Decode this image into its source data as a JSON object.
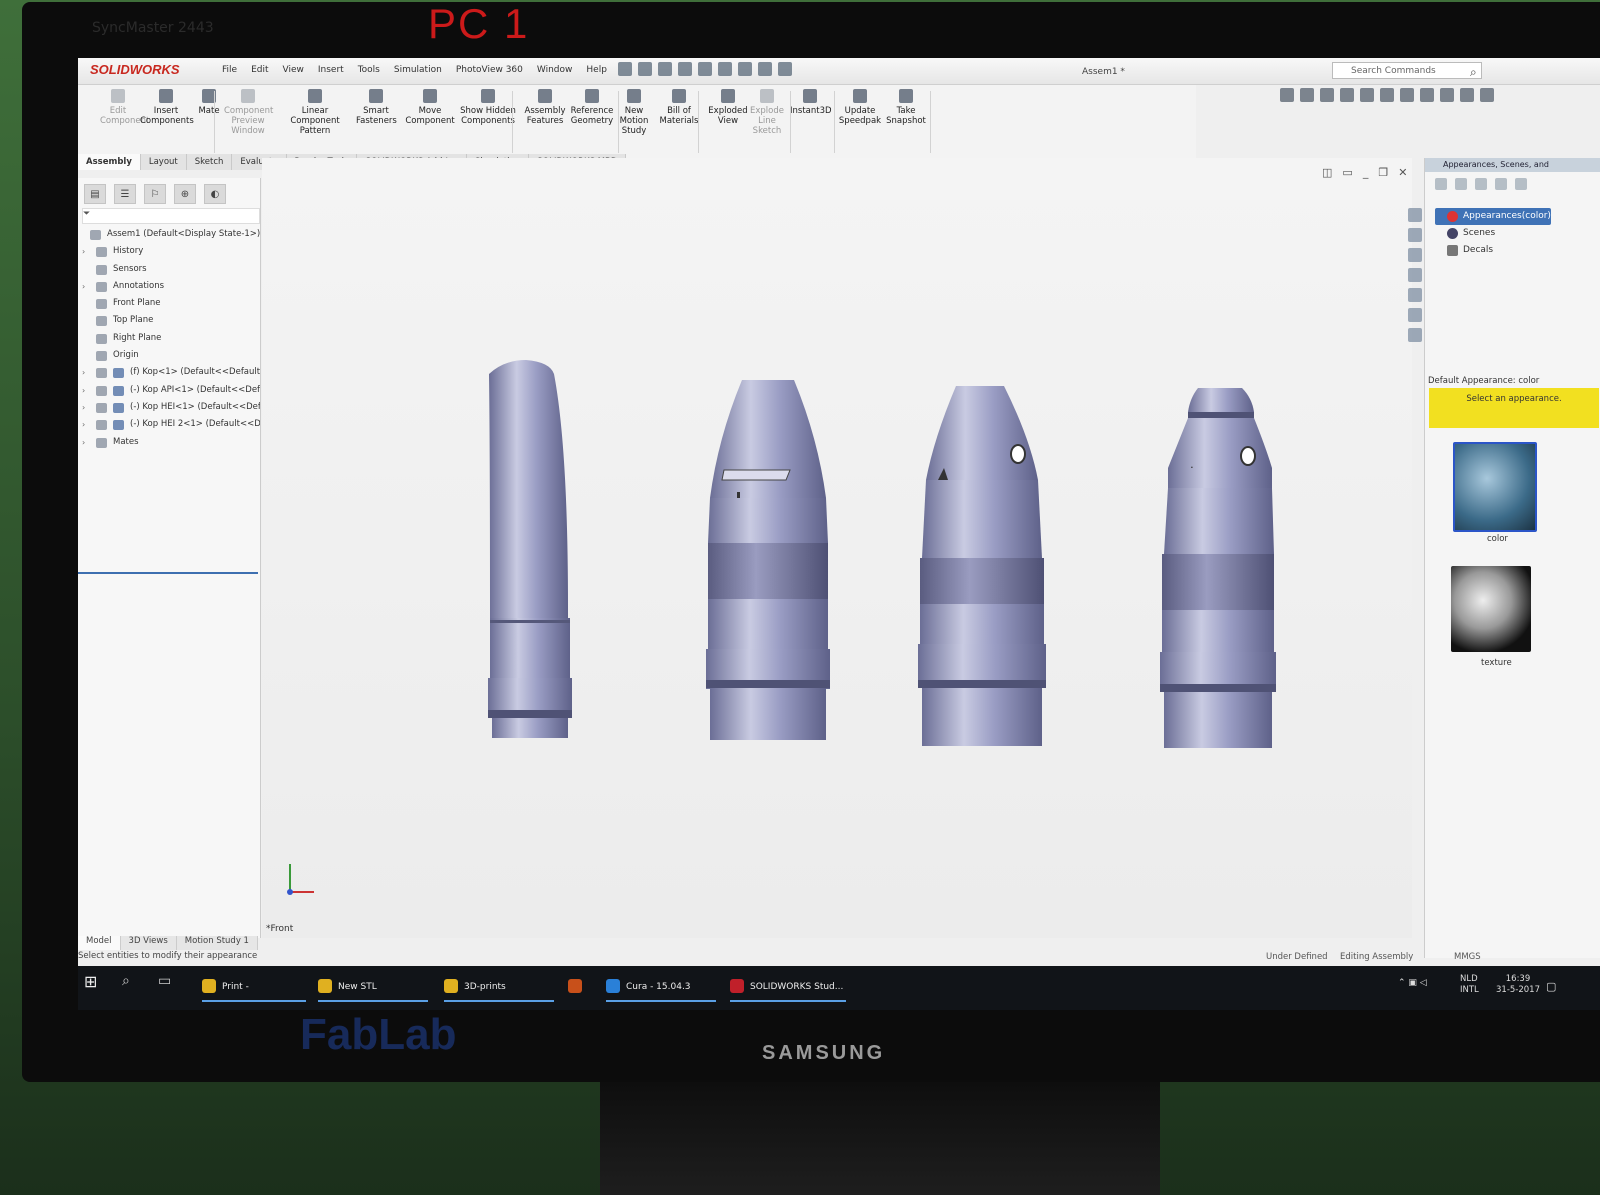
{
  "photo": {
    "pc_label": "PC 1",
    "monitor_brand_top": "SyncMaster 2443",
    "monitor_brand": "SAMSUNG",
    "wall_sign": "FabLab"
  },
  "app": {
    "logo": "SOLIDWORKS",
    "menus": [
      "File",
      "Edit",
      "View",
      "Insert",
      "Tools",
      "Simulation",
      "PhotoView 360",
      "Window",
      "Help"
    ],
    "doc_title": "Assem1 *",
    "search_placeholder": "Search Commands"
  },
  "commands": [
    {
      "label": "Edit Component",
      "icon": "edit-component-icon",
      "enabled": false
    },
    {
      "label": "Insert Components",
      "icon": "insert-components-icon",
      "enabled": true
    },
    {
      "label": "Mate",
      "icon": "mate-icon",
      "enabled": true
    },
    {
      "label": "Component Preview Window",
      "icon": "preview-window-icon",
      "enabled": false
    },
    {
      "label": "Linear Component Pattern",
      "icon": "linear-pattern-icon",
      "enabled": true
    },
    {
      "label": "Smart Fasteners",
      "icon": "smart-fasteners-icon",
      "enabled": true
    },
    {
      "label": "Move Component",
      "icon": "move-component-icon",
      "enabled": true
    },
    {
      "label": "Show Hidden Components",
      "icon": "show-hidden-icon",
      "enabled": true
    },
    {
      "label": "Assembly Features",
      "icon": "assembly-features-icon",
      "enabled": true
    },
    {
      "label": "Reference Geometry",
      "icon": "reference-geometry-icon",
      "enabled": true
    },
    {
      "label": "New Motion Study",
      "icon": "motion-study-icon",
      "enabled": true
    },
    {
      "label": "Bill of Materials",
      "icon": "bom-icon",
      "enabled": true
    },
    {
      "label": "Exploded View",
      "icon": "exploded-view-icon",
      "enabled": true
    },
    {
      "label": "Explode Line Sketch",
      "icon": "explode-line-icon",
      "enabled": false
    },
    {
      "label": "Instant3D",
      "icon": "instant3d-icon",
      "enabled": true
    },
    {
      "label": "Update Speedpak",
      "icon": "speedpak-icon",
      "enabled": true
    },
    {
      "label": "Take Snapshot",
      "icon": "snapshot-icon",
      "enabled": true
    }
  ],
  "tabs": [
    "Assembly",
    "Layout",
    "Sketch",
    "Evaluate",
    "Render Tools",
    "SOLIDWORKS Add-Ins",
    "Simulation",
    "SOLIDWORKS MBD"
  ],
  "active_tab": "Assembly",
  "tree": [
    {
      "label": "Assem1  (Default<Display State-1>)",
      "expand": false,
      "indent": 0
    },
    {
      "label": "History",
      "expand": true,
      "indent": 1
    },
    {
      "label": "Sensors",
      "expand": false,
      "indent": 1
    },
    {
      "label": "Annotations",
      "expand": true,
      "indent": 1
    },
    {
      "label": "Front Plane",
      "expand": false,
      "indent": 1
    },
    {
      "label": "Top Plane",
      "expand": false,
      "indent": 1
    },
    {
      "label": "Right Plane",
      "expand": false,
      "indent": 1
    },
    {
      "label": "Origin",
      "expand": false,
      "indent": 1
    },
    {
      "label": "(f) Kop<1> (Default<<Default>",
      "expand": true,
      "indent": 2
    },
    {
      "label": "(-) Kop API<1> (Default<<Defa",
      "expand": true,
      "indent": 2
    },
    {
      "label": "(-) Kop HEI<1> (Default<<Defa",
      "expand": true,
      "indent": 2
    },
    {
      "label": "(-) Kop HEI 2<1> (Default<<De",
      "expand": true,
      "indent": 2
    },
    {
      "label": "Mates",
      "expand": true,
      "indent": 1
    }
  ],
  "bottom_tabs": [
    "Model",
    "3D Views",
    "Motion Study 1"
  ],
  "view_name": "*Front",
  "status": {
    "message": "Select entities to modify their appearance",
    "state": "Under Defined",
    "mode": "Editing Assembly",
    "units": "MMGS"
  },
  "taskpane": {
    "title": "Appearances, Scenes, and",
    "items": [
      "Appearances(color)",
      "Scenes",
      "Decals"
    ],
    "default_label": "Default Appearance: color",
    "prompt": "Select an appearance.",
    "swatch1": "color",
    "swatch2": "texture"
  },
  "taskbar": {
    "apps": [
      "Print - okeeffesam...",
      "New STL",
      "3D-prints",
      "",
      "Cura - 15.04.3",
      "SOLIDWORKS Stud..."
    ],
    "lang1": "NLD",
    "lang2": "INTL",
    "time": "16:39",
    "date": "31-5-2017"
  },
  "colors": {
    "accent": "#3f72b6",
    "model": "#8c8fb8",
    "yellow": "#f2e020"
  }
}
